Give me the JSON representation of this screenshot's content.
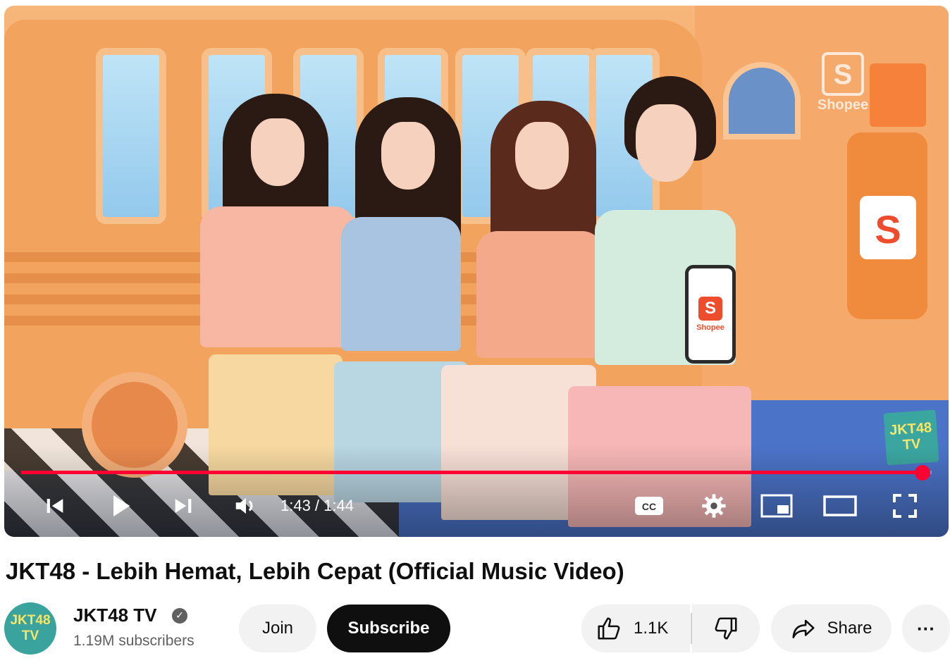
{
  "player": {
    "current_time": "1:43",
    "duration": "1:44",
    "time_display": "1:43 / 1:44",
    "progress": 0.99,
    "brand_watermark": "Shopee",
    "brand_letter": "S",
    "channel_watermark": "JKT48 TV",
    "phone_logo_letter": "S",
    "phone_label": "Shopee",
    "controls": [
      "previous",
      "play",
      "next",
      "volume",
      "captions",
      "settings",
      "miniplayer",
      "theater-mode",
      "fullscreen"
    ]
  },
  "video": {
    "title": "JKT48 - Lebih Hemat, Lebih Cepat (Official Music Video)"
  },
  "channel": {
    "name": "JKT48 TV",
    "verified": true,
    "subscribers": "1.19M subscribers",
    "avatar_text": "JKT48 TV"
  },
  "actions": {
    "join_label": "Join",
    "subscribe_label": "Subscribe",
    "like_count": "1.1K",
    "share_label": "Share",
    "more_label": "···"
  },
  "colors": {
    "progress_red": "#ff0033",
    "subscribe_bg": "#0f0f0f",
    "pill_bg": "#f2f2f2",
    "shopee_orange": "#ee4d2d"
  }
}
